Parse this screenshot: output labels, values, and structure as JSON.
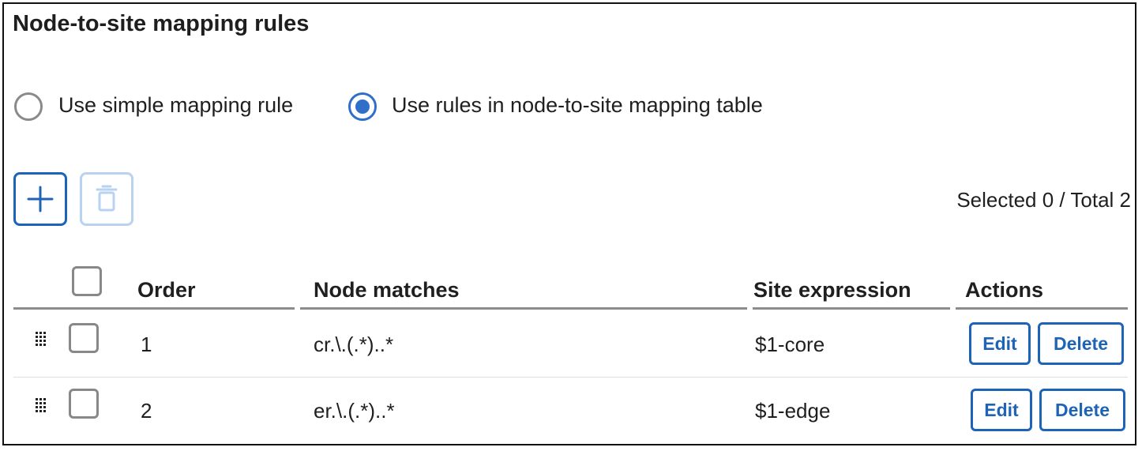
{
  "panel": {
    "title": "Node-to-site mapping rules"
  },
  "mapping_mode": {
    "options": [
      {
        "label": "Use simple mapping rule",
        "selected": false
      },
      {
        "label": "Use rules in node-to-site mapping table",
        "selected": true
      }
    ]
  },
  "toolbar": {
    "add_icon": "plus-icon",
    "delete_icon": "trash-icon",
    "delete_enabled": false,
    "selection_count": "Selected 0 / Total 2"
  },
  "table": {
    "columns": [
      "Order",
      "Node matches",
      "Site expression",
      "Actions"
    ],
    "rows": [
      {
        "order": "1",
        "node_matches": "cr.\\.(.*)..*",
        "site_expression": "$1-core",
        "edit_label": "Edit",
        "delete_label": "Delete"
      },
      {
        "order": "2",
        "node_matches": "er.\\.(.*)..*",
        "site_expression": "$1-edge",
        "edit_label": "Edit",
        "delete_label": "Delete"
      }
    ]
  },
  "colors": {
    "accent": "#1d63b8",
    "radio_selected": "#2f6fc9",
    "disabled": "#b9d2f1"
  }
}
